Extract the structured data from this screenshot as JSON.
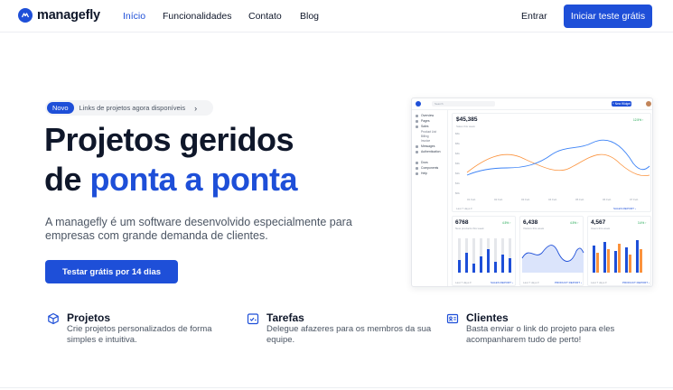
{
  "header": {
    "logo_text": "managefly",
    "nav": [
      "Início",
      "Funcionalidades",
      "Contato",
      "Blog"
    ],
    "login": "Entrar",
    "cta": "Iniciar teste grátis"
  },
  "hero": {
    "badge_pill": "Novo",
    "badge_text": "Links de projetos agora disponíveis",
    "badge_arrow": "›",
    "title_line1": "Projetos geridos",
    "title_line2_prefix": "de ",
    "title_line2_accent": "ponta a ponta",
    "lead": "A managefly é um software desenvolvido especialmente para empresas com grande demanda de clientes.",
    "cta": "Testar grátis por 14 dias"
  },
  "features": [
    {
      "icon": "cube-icon",
      "title": "Projetos",
      "desc": "Crie projetos personalizados de forma simples e intuitiva."
    },
    {
      "icon": "checklist-icon",
      "title": "Tarefas",
      "desc": "Delegue afazeres para os membros da sua equipe."
    },
    {
      "icon": "contact-card-icon",
      "title": "Clientes",
      "desc": "Basta enviar o link do projeto para eles acompanharem tudo de perto!"
    }
  ],
  "colors": {
    "brand": "#1e4fd8",
    "text": "#0f172a",
    "muted": "#4b5563"
  },
  "dashboard": {
    "search_placeholder": "Search",
    "new_button": "+ New Widget",
    "sidebar": [
      {
        "label": "Overview"
      },
      {
        "label": "Pages"
      },
      {
        "label": "Sales"
      },
      {
        "label": "Product List"
      },
      {
        "label": "Billing"
      },
      {
        "label": "Invoice"
      },
      {
        "label": "Messages"
      },
      {
        "label": "Authentication"
      },
      {
        "label": "Docs"
      },
      {
        "label": "Components"
      },
      {
        "label": "Help"
      }
    ],
    "main": {
      "value": "$45,385",
      "subtitle": "Sales this week",
      "change": "12.5% ↑",
      "footer_left": "Last 7 days ▾",
      "footer_right": "SALES REPORT ›",
      "y_ticks": [
        "$6k",
        "$5k",
        "$4k",
        "$3k",
        "$2k",
        "$1k",
        "$0k"
      ],
      "x_ticks": [
        "01 Feb",
        "02 Feb",
        "03 Feb",
        "04 Feb",
        "05 Feb",
        "06 Feb",
        "07 Feb"
      ]
    },
    "cards": [
      {
        "value": "6768",
        "subtitle": "New products this week",
        "change": "4.5% ↑",
        "footer_left": "Last 7 days ▾",
        "footer_right": "SALES REPORT ›"
      },
      {
        "value": "6,438",
        "subtitle": "Visitors this week",
        "change": "4.5% ↑",
        "footer_left": "Last 7 days ▾",
        "footer_right": "PRODUCT REPORT ›"
      },
      {
        "value": "4,567",
        "subtitle": "Users this week",
        "change": "3.4% ↑",
        "footer_left": "Last 7 days ▾",
        "footer_right": "PRODUCT REPORT ›"
      }
    ]
  }
}
